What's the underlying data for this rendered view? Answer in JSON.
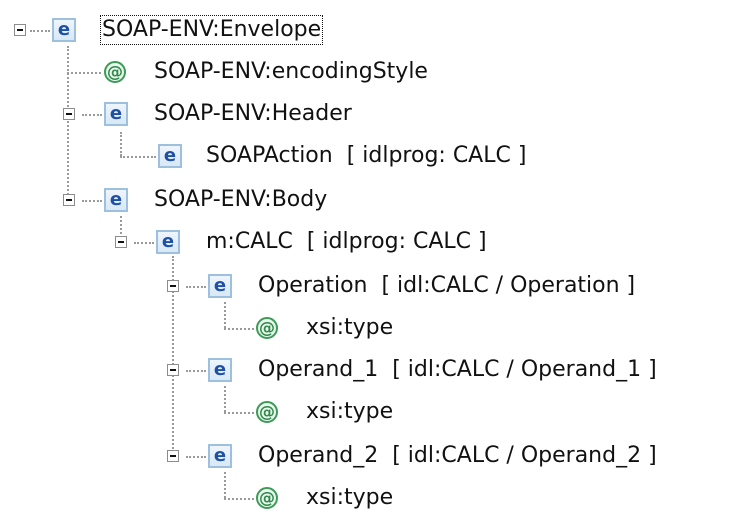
{
  "tree": {
    "root": {
      "label": "SOAP-ENV:Envelope",
      "icon": "element-icon",
      "children": {
        "encoding": {
          "label": "SOAP-ENV:encodingStyle",
          "icon": "attribute-icon"
        },
        "header": {
          "label": "SOAP-ENV:Header",
          "soapaction": "SOAPAction  [ idlprog: CALC ]"
        },
        "body": {
          "label": "SOAP-ENV:Body",
          "calc": {
            "label": "m:CALC  [ idlprog: CALC ]",
            "operation": {
              "label": "Operation  [ idl:CALC / Operation ]",
              "attr": "xsi:type"
            },
            "operand1": {
              "label": "Operand_1  [ idl:CALC / Operand_1 ]",
              "attr": "xsi:type"
            },
            "operand2": {
              "label": "Operand_2  [ idl:CALC / Operand_2 ]",
              "attr": "xsi:type"
            }
          }
        }
      }
    },
    "icon_glyphs": {
      "element": "e",
      "attribute": "@"
    }
  }
}
